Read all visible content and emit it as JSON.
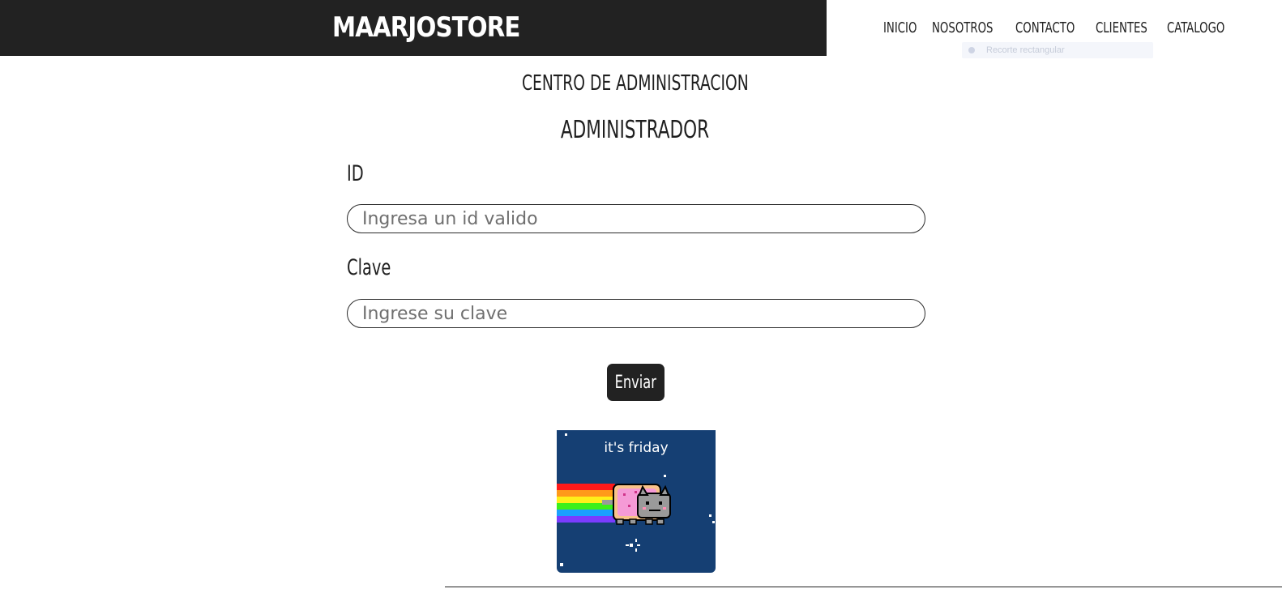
{
  "header": {
    "brand": "MAARJOSTORE",
    "nav": [
      "INICIO",
      "NOSOTROS",
      "CONTACTO",
      "CLIENTES",
      "CATALOGO"
    ],
    "ghost_tooltip": "Recorte rectangular"
  },
  "main": {
    "title": "CENTRO DE ADMINISTRACION",
    "subtitle": "ADMINISTRADOR",
    "id_label": "ID",
    "id_placeholder": "Ingresa un id valido",
    "clave_label": "Clave",
    "clave_placeholder": "Ingrese su clave",
    "submit_label": "Enviar"
  },
  "image": {
    "caption": "it's friday"
  },
  "colors": {
    "header_bg": "#222222",
    "button_bg": "#222222",
    "image_bg": "#153f73"
  }
}
